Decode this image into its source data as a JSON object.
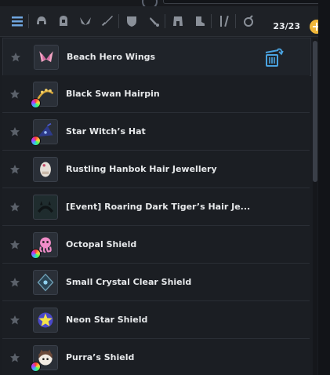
{
  "inventory": {
    "count_label": "23/23",
    "add_symbol": "+"
  },
  "toolbar": {
    "filters": [
      "list-icon",
      "helmet-icon",
      "hood-icon",
      "wings-icon",
      "sword-icon",
      "shield-icon",
      "dagger-icon",
      "armor-icon",
      "boots-icon",
      "tools-icon",
      "ring-icon"
    ]
  },
  "items": [
    {
      "name": "Beach Hero Wings",
      "icon": "wings-icon",
      "dyeable": false
    },
    {
      "name": "Black Swan Hairpin",
      "icon": "hairpin-icon",
      "dyeable": true
    },
    {
      "name": "Star Witch’s Hat",
      "icon": "hat-icon",
      "dyeable": true
    },
    {
      "name": "Rustling Hanbok Hair Jewellery",
      "icon": "hair-jewellery-icon",
      "dyeable": false
    },
    {
      "name": "[Event] Roaring Dark Tiger’s Hair Je...",
      "icon": "tiger-hair-icon",
      "dyeable": false
    },
    {
      "name": "Octopal Shield",
      "icon": "octopus-shield-icon",
      "dyeable": true
    },
    {
      "name": "Small Crystal Clear Shield",
      "icon": "crystal-shield-icon",
      "dyeable": false
    },
    {
      "name": "Neon Star Shield",
      "icon": "star-shield-icon",
      "dyeable": false
    },
    {
      "name": "Purra’s Shield",
      "icon": "cat-shield-icon",
      "dyeable": true
    }
  ],
  "colors": {
    "accent": "#f0b73a",
    "background": "#1a1d22",
    "row_border": "#2a2e35",
    "trash": "#4aa3e0"
  }
}
